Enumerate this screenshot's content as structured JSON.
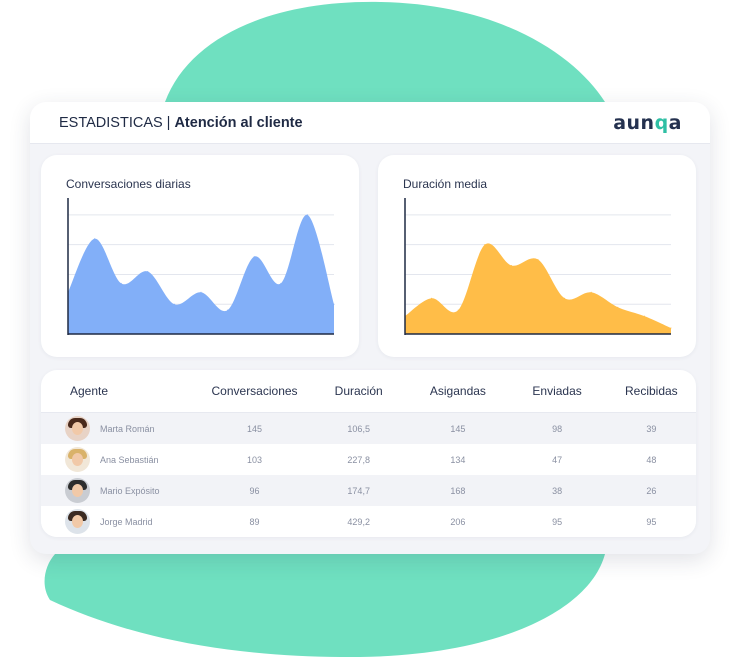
{
  "header": {
    "title_prefix": "ESTADISTICAS",
    "separator": "|",
    "title_main": "Atención al cliente",
    "logo_main": "aun",
    "logo_accent": "q",
    "logo_end": "a"
  },
  "colors": {
    "blob": "#6fe0c0",
    "chart1_fill": "#82aff8",
    "chart2_fill": "#ffbd48",
    "logo": "#24314f",
    "logo_accent": "#2fbfa4"
  },
  "charts": [
    {
      "title": "Conversaciones diarias",
      "color": "#82aff8"
    },
    {
      "title": "Duración media",
      "color": "#ffbd48"
    }
  ],
  "chart_data": [
    {
      "type": "area",
      "title": "Conversaciones diarias",
      "values": [
        1.4,
        3.2,
        1.7,
        2.1,
        1.0,
        1.4,
        0.8,
        2.6,
        1.7,
        4.0,
        1.0
      ],
      "ylim": [
        0,
        4.5
      ],
      "grid": true
    },
    {
      "type": "area",
      "title": "Duración media",
      "values": [
        0.6,
        1.2,
        0.8,
        3.0,
        2.3,
        2.5,
        1.2,
        1.4,
        0.9,
        0.6,
        0.2
      ],
      "ylim": [
        0,
        4.5
      ],
      "grid": true
    }
  ],
  "table": {
    "columns": [
      "Agente",
      "Conversaciones",
      "Duración",
      "Asigandas",
      "Enviadas",
      "Recibidas"
    ],
    "rows": [
      {
        "name": "Marta Román",
        "conversaciones": "145",
        "duracion": "106,5",
        "asignadas": "145",
        "enviadas": "98",
        "recibidas": "39",
        "avatar_hair": "#4a2a1c",
        "avatar_bg": "#e8d3c6"
      },
      {
        "name": "Ana Sebastián",
        "conversaciones": "103",
        "duracion": "227,8",
        "asignadas": "134",
        "enviadas": "47",
        "recibidas": "48",
        "avatar_hair": "#d9b26a",
        "avatar_bg": "#f1e7d8"
      },
      {
        "name": "Mario Expósito",
        "conversaciones": "96",
        "duracion": "174,7",
        "asignadas": "168",
        "enviadas": "38",
        "recibidas": "26",
        "avatar_hair": "#2d2d2d",
        "avatar_bg": "#c9ccd2"
      },
      {
        "name": "Jorge Madrid",
        "conversaciones": "89",
        "duracion": "429,2",
        "asignadas": "206",
        "enviadas": "95",
        "recibidas": "95",
        "avatar_hair": "#3a2a22",
        "avatar_bg": "#dde3ea"
      }
    ]
  }
}
